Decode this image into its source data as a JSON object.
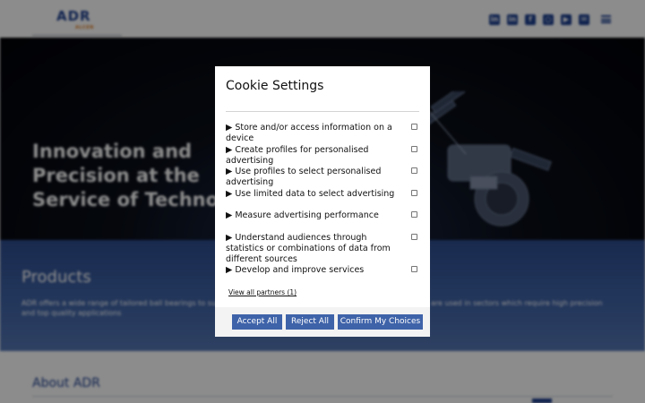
{
  "header": {
    "logo_main": "ADR",
    "logo_sub": "ALCEN",
    "social": [
      "in-icon",
      "linkedin-icon",
      "facebook-icon",
      "instagram-icon",
      "youtube-icon",
      "email-icon"
    ],
    "menu_icon": "hamburger-menu-icon"
  },
  "hero": {
    "title": "Innovation and Precision at the Service of Technology",
    "title_visible": "Innovation and Preci… at the Service of Tec…"
  },
  "products": {
    "title": "Products",
    "text": "ADR offers a wide range of tailored ball bearings to suit a wide range of applications and industries. Our bearings are used in sectors which require high precision and top quality applications"
  },
  "about": {
    "title": "About ADR"
  },
  "modal": {
    "title": "Cookie Settings",
    "options": [
      {
        "label": "▶ Store and/or access information on a device",
        "checked": false
      },
      {
        "label": "▶ Create profiles for personalised advertising",
        "checked": false
      },
      {
        "label": "▶ Use profiles to select personalised advertising",
        "checked": false
      },
      {
        "label": "▶ Use limited data to select advertising",
        "checked": false
      },
      {
        "label": "▶ Measure advertising performance",
        "checked": false
      },
      {
        "label": "▶ Understand audiences through statistics or combinations of data from different sources",
        "checked": false
      },
      {
        "label": "▶ Develop and improve services",
        "checked": false
      }
    ],
    "partners_link": "View all partners (1)",
    "buttons": {
      "accept": "Accept All",
      "reject": "Reject All",
      "confirm": "Confirm My Choices"
    }
  },
  "colors": {
    "brand_blue": "#1d3f8f",
    "button_blue": "#3f63a9",
    "accent_orange": "#e07a1f"
  }
}
